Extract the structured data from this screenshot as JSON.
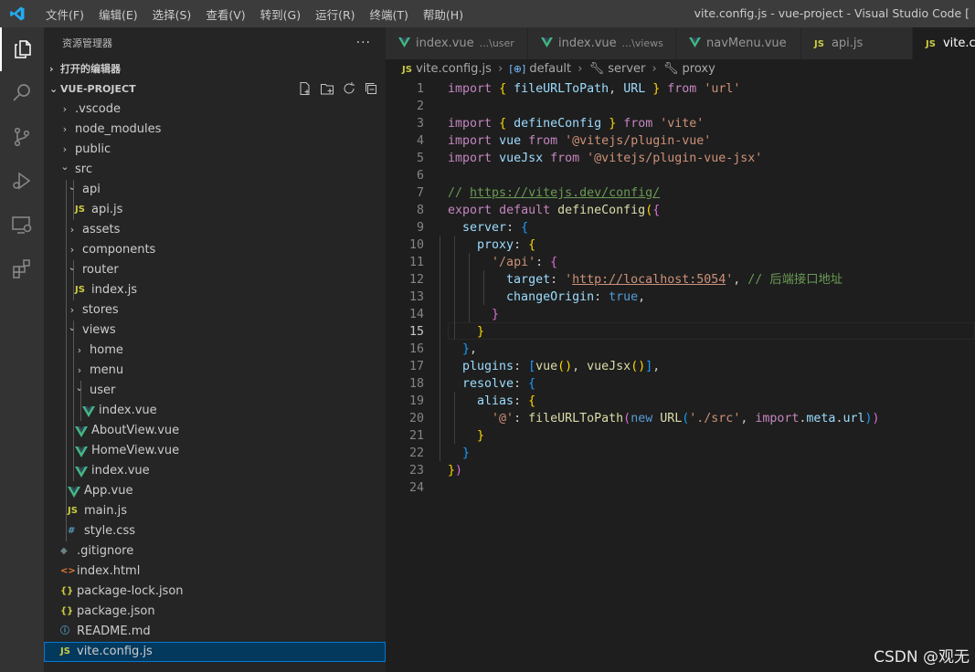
{
  "window": {
    "title": "vite.config.js - vue-project - Visual Studio Code [",
    "menu": [
      "文件(F)",
      "编辑(E)",
      "选择(S)",
      "查看(V)",
      "转到(G)",
      "运行(R)",
      "终端(T)",
      "帮助(H)"
    ]
  },
  "activity_bar": [
    "explorer-icon",
    "search-icon",
    "source-control-icon",
    "run-debug-icon",
    "remote-explorer-icon",
    "extensions-icon"
  ],
  "sidebar": {
    "title": "资源管理器",
    "more": "···",
    "open_editors": "打开的编辑器",
    "project": "VUE-PROJECT",
    "tree": [
      {
        "label": ".vscode",
        "type": "folder",
        "open": false
      },
      {
        "label": "node_modules",
        "type": "folder",
        "open": false
      },
      {
        "label": "public",
        "type": "folder",
        "open": false
      },
      {
        "label": "src",
        "type": "folder",
        "open": true
      },
      {
        "label": "api",
        "type": "folder",
        "open": true
      },
      {
        "label": "api.js",
        "type": "js",
        "icon": "JS"
      },
      {
        "label": "assets",
        "type": "folder",
        "open": false
      },
      {
        "label": "components",
        "type": "folder",
        "open": false
      },
      {
        "label": "router",
        "type": "folder",
        "open": true
      },
      {
        "label": "index.js",
        "type": "js",
        "icon": "JS"
      },
      {
        "label": "stores",
        "type": "folder",
        "open": false
      },
      {
        "label": "views",
        "type": "folder",
        "open": true
      },
      {
        "label": "home",
        "type": "folder",
        "open": false
      },
      {
        "label": "menu",
        "type": "folder",
        "open": false
      },
      {
        "label": "user",
        "type": "folder",
        "open": true
      },
      {
        "label": "index.vue",
        "type": "vue"
      },
      {
        "label": "AboutView.vue",
        "type": "vue"
      },
      {
        "label": "HomeView.vue",
        "type": "vue"
      },
      {
        "label": "index.vue",
        "type": "vue"
      },
      {
        "label": "App.vue",
        "type": "vue"
      },
      {
        "label": "main.js",
        "type": "js",
        "icon": "JS"
      },
      {
        "label": "style.css",
        "type": "css",
        "icon": "#"
      },
      {
        "label": ".gitignore",
        "type": "git",
        "icon": "◆"
      },
      {
        "label": "index.html",
        "type": "html",
        "icon": "<>"
      },
      {
        "label": "package-lock.json",
        "type": "json",
        "icon": "{}"
      },
      {
        "label": "package.json",
        "type": "json",
        "icon": "{}"
      },
      {
        "label": "README.md",
        "type": "info",
        "icon": "ⓘ"
      },
      {
        "label": "vite.config.js",
        "type": "js",
        "icon": "JS",
        "selected": true
      }
    ]
  },
  "tabs": [
    {
      "label": "index.vue",
      "desc": "...\\user",
      "type": "vue"
    },
    {
      "label": "index.vue",
      "desc": "...\\views",
      "type": "vue"
    },
    {
      "label": "navMenu.vue",
      "desc": "",
      "type": "vue"
    },
    {
      "label": "api.js",
      "desc": "",
      "type": "js",
      "icon": "JS"
    },
    {
      "label": "vite.co",
      "desc": "",
      "type": "js",
      "icon": "JS",
      "active": true
    }
  ],
  "breadcrumb": {
    "file_icon": "JS",
    "file": "vite.config.js",
    "items": [
      "default",
      "server",
      "proxy"
    ]
  },
  "editor": {
    "current_line": 15,
    "lines": [
      [
        [
          "k",
          "import"
        ],
        [
          "p",
          " "
        ],
        [
          "br1",
          "{"
        ],
        [
          "p",
          " "
        ],
        [
          "v",
          "fileURLToPath"
        ],
        [
          "p",
          ", "
        ],
        [
          "v",
          "URL"
        ],
        [
          "p",
          " "
        ],
        [
          "br1",
          "}"
        ],
        [
          "p",
          " "
        ],
        [
          "k",
          "from"
        ],
        [
          "p",
          " "
        ],
        [
          "s",
          "'url'"
        ]
      ],
      [],
      [
        [
          "k",
          "import"
        ],
        [
          "p",
          " "
        ],
        [
          "br1",
          "{"
        ],
        [
          "p",
          " "
        ],
        [
          "v",
          "defineConfig"
        ],
        [
          "p",
          " "
        ],
        [
          "br1",
          "}"
        ],
        [
          "p",
          " "
        ],
        [
          "k",
          "from"
        ],
        [
          "p",
          " "
        ],
        [
          "s",
          "'vite'"
        ]
      ],
      [
        [
          "k",
          "import"
        ],
        [
          "p",
          " "
        ],
        [
          "v",
          "vue"
        ],
        [
          "p",
          " "
        ],
        [
          "k",
          "from"
        ],
        [
          "p",
          " "
        ],
        [
          "s",
          "'@vitejs/plugin-vue'"
        ]
      ],
      [
        [
          "k",
          "import"
        ],
        [
          "p",
          " "
        ],
        [
          "v",
          "vueJsx"
        ],
        [
          "p",
          " "
        ],
        [
          "k",
          "from"
        ],
        [
          "p",
          " "
        ],
        [
          "s",
          "'@vitejs/plugin-vue-jsx'"
        ]
      ],
      [],
      [
        [
          "c",
          "// "
        ],
        [
          "cu",
          "https://vitejs.dev/config/"
        ]
      ],
      [
        [
          "k",
          "export"
        ],
        [
          "p",
          " "
        ],
        [
          "k",
          "default"
        ],
        [
          "p",
          " "
        ],
        [
          "f",
          "defineConfig"
        ],
        [
          "br1",
          "("
        ],
        [
          "br2",
          "{"
        ]
      ],
      [
        [
          "p",
          "  "
        ],
        [
          "v",
          "server"
        ],
        [
          "p",
          ": "
        ],
        [
          "br3",
          "{"
        ]
      ],
      [
        [
          "p",
          "    "
        ],
        [
          "v",
          "proxy"
        ],
        [
          "p",
          ": "
        ],
        [
          "br1",
          "{"
        ]
      ],
      [
        [
          "p",
          "      "
        ],
        [
          "s",
          "'/api'"
        ],
        [
          "p",
          ": "
        ],
        [
          "br2",
          "{"
        ]
      ],
      [
        [
          "p",
          "        "
        ],
        [
          "v",
          "target"
        ],
        [
          "p",
          ": "
        ],
        [
          "s",
          "'"
        ],
        [
          "su",
          "http://localhost:5054"
        ],
        [
          "s",
          "'"
        ],
        [
          "p",
          ", "
        ],
        [
          "c",
          "// 后端接口地址"
        ]
      ],
      [
        [
          "p",
          "        "
        ],
        [
          "v",
          "changeOrigin"
        ],
        [
          "p",
          ": "
        ],
        [
          "b",
          "true"
        ],
        [
          "p",
          ","
        ]
      ],
      [
        [
          "p",
          "      "
        ],
        [
          "br2",
          "}"
        ]
      ],
      [
        [
          "p",
          "    "
        ],
        [
          "br1",
          "}"
        ]
      ],
      [
        [
          "p",
          "  "
        ],
        [
          "br3",
          "}"
        ],
        [
          "p",
          ","
        ]
      ],
      [
        [
          "p",
          "  "
        ],
        [
          "v",
          "plugins"
        ],
        [
          "p",
          ": "
        ],
        [
          "br3",
          "["
        ],
        [
          "f",
          "vue"
        ],
        [
          "br1",
          "()"
        ],
        [
          "p",
          ", "
        ],
        [
          "f",
          "vueJsx"
        ],
        [
          "br1",
          "()"
        ],
        [
          "br3",
          "]"
        ],
        [
          "p",
          ","
        ]
      ],
      [
        [
          "p",
          "  "
        ],
        [
          "v",
          "resolve"
        ],
        [
          "p",
          ": "
        ],
        [
          "br3",
          "{"
        ]
      ],
      [
        [
          "p",
          "    "
        ],
        [
          "v",
          "alias"
        ],
        [
          "p",
          ": "
        ],
        [
          "br1",
          "{"
        ]
      ],
      [
        [
          "p",
          "      "
        ],
        [
          "s",
          "'@'"
        ],
        [
          "p",
          ": "
        ],
        [
          "f",
          "fileURLToPath"
        ],
        [
          "br2",
          "("
        ],
        [
          "b",
          "new"
        ],
        [
          "p",
          " "
        ],
        [
          "f",
          "URL"
        ],
        [
          "br3",
          "("
        ],
        [
          "s",
          "'./src'"
        ],
        [
          "p",
          ", "
        ],
        [
          "k",
          "import"
        ],
        [
          "p",
          "."
        ],
        [
          "v",
          "meta"
        ],
        [
          "p",
          "."
        ],
        [
          "v",
          "url"
        ],
        [
          "br3",
          ")"
        ],
        [
          "br2",
          ")"
        ]
      ],
      [
        [
          "p",
          "    "
        ],
        [
          "br1",
          "}"
        ]
      ],
      [
        [
          "p",
          "  "
        ],
        [
          "br3",
          "}"
        ]
      ],
      [
        [
          "br1",
          "}"
        ],
        [
          "br2",
          ")"
        ]
      ],
      []
    ]
  },
  "watermark": "CSDN @观无",
  "colors": {
    "accent": "#0078d4",
    "vue": "#42b883",
    "js": "#cbcb41"
  }
}
